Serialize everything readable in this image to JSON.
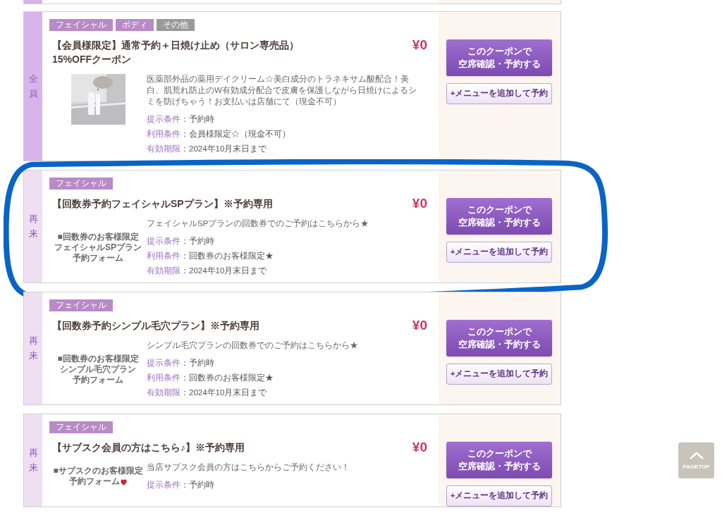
{
  "coupons": [
    {
      "audience": "全員",
      "color": "#d9b4ec",
      "circled": false,
      "tags": [
        {
          "label": "フェイシャル",
          "color": "#b98ac6"
        },
        {
          "label": "ボディ",
          "color": "#b98ac6"
        },
        {
          "label": "その他",
          "color": "#9a9a9a"
        }
      ],
      "title": "【会員様限定】通常予約＋日焼け止め（サロン専売品）15%OFFクーポン",
      "price": "¥0",
      "thumbnail": {
        "kind": "picture"
      },
      "description": "医薬部外品の薬用デイクリーム☆美白成分のトラネキサム酸配合！美白、肌荒れ防止のW有効成分配合で皮膚を保護しながら日焼けによるシミを防げちゃう！お支払いは店舗にて（現金不可）",
      "conditions": [
        {
          "label": "提示条件",
          "value": "：予約時"
        },
        {
          "label": "利用条件",
          "value": "：会員様限定☆（現金不可）"
        },
        {
          "label": "有効期限",
          "value": "：2024年10月末日まで"
        }
      ],
      "buttons": [
        {
          "kind": "primary",
          "label_lines": [
            "このクーポンで",
            "空席確認・予約する"
          ]
        },
        {
          "kind": "secondary",
          "label": "+メニューを追加して予約"
        }
      ]
    },
    {
      "audience": "再来",
      "color": "#eedff2",
      "circled": true,
      "tags": [
        {
          "label": "フェイシャル",
          "color": "#b98ac6"
        }
      ],
      "title": "【回数券予約フェイシャルSPプラン】※予約専用",
      "price": "¥0",
      "thumbnail": {
        "kind": "banner",
        "lines": [
          "■回数券のお客様限定",
          "フェイシャルSPプラン",
          "予約フォーム"
        ]
      },
      "description": "フェイシャルSPプランの回数券でのご予約はこちらから★",
      "conditions": [
        {
          "label": "提示条件",
          "value": "：予約時"
        },
        {
          "label": "利用条件",
          "value": "：回数券のお客様限定★"
        },
        {
          "label": "有効期限",
          "value": "：2024年10月末日まで"
        }
      ],
      "buttons": [
        {
          "kind": "primary",
          "label_lines": [
            "このクーポンで",
            "空席確認・予約する"
          ]
        },
        {
          "kind": "secondary",
          "label": "+メニューを追加して予約"
        }
      ]
    },
    {
      "audience": "再来",
      "color": "#eedff2",
      "circled": false,
      "tags": [
        {
          "label": "フェイシャル",
          "color": "#b98ac6"
        }
      ],
      "title": "【回数券予約シンプル毛穴プラン】※予約専用",
      "price": "¥0",
      "thumbnail": {
        "kind": "banner",
        "lines": [
          "■回数券のお客様限定",
          "シンプル毛穴プラン",
          "予約フォーム"
        ]
      },
      "description": "シンプル毛穴プランの回数券でのご予約はこちらから★",
      "conditions": [
        {
          "label": "提示条件",
          "value": "：予約時"
        },
        {
          "label": "利用条件",
          "value": "：回数券のお客様限定★"
        },
        {
          "label": "有効期限",
          "value": "：2024年10月末日まで"
        }
      ],
      "buttons": [
        {
          "kind": "primary",
          "label_lines": [
            "このクーポンで",
            "空席確認・予約する"
          ]
        },
        {
          "kind": "secondary",
          "label": "+メニューを追加して予約"
        }
      ]
    },
    {
      "audience": "再来",
      "color": "#eedff2",
      "circled": false,
      "tags": [
        {
          "label": "フェイシャル",
          "color": "#b98ac6"
        }
      ],
      "title": "【サブスク会員の方はこちら♪】※予約専用",
      "price": "¥0",
      "thumbnail": {
        "kind": "banner-berry",
        "lines": [
          "■サブスクのお客様限定",
          "予約フォーム"
        ]
      },
      "description": "当店サブスク会員の方はこちらからご予約ください！",
      "conditions": [
        {
          "label": "提示条件",
          "value": "：予約時"
        }
      ],
      "buttons": [
        {
          "kind": "primary",
          "label_lines": [
            "このクーポンで",
            "空席確認・予約する"
          ]
        },
        {
          "kind": "secondary",
          "label": "+メニューを追加して予約"
        }
      ]
    }
  ],
  "pagetop": {
    "label": "PAGETOP"
  }
}
